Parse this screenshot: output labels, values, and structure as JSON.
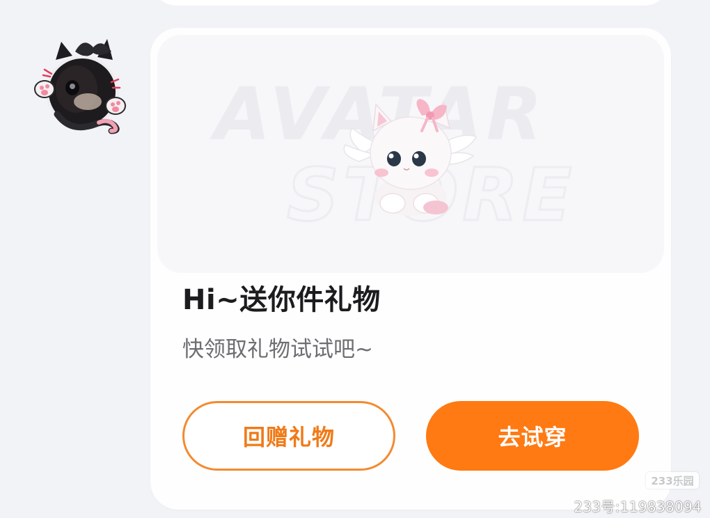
{
  "banner": {
    "bg_text_line1": "AVATAR",
    "bg_text_line2": "STORE"
  },
  "gift_card": {
    "title": "Hi~送你件礼物",
    "subtitle": "快领取礼物试试吧~"
  },
  "actions": {
    "return_gift_label": "回赠礼物",
    "try_on_label": "去试穿"
  },
  "watermark": {
    "logo": "233乐园",
    "id_text": "233号:119838094"
  },
  "colors": {
    "accent_orange": "#ff7a12",
    "outline_orange": "#f48a30",
    "page_bg": "#f2f3f7",
    "card_bg": "#fefefe"
  },
  "icons": {
    "avatar": "black-cat-with-bow-avatar",
    "banner_art": "white-winged-kitten-with-pink-bow"
  }
}
